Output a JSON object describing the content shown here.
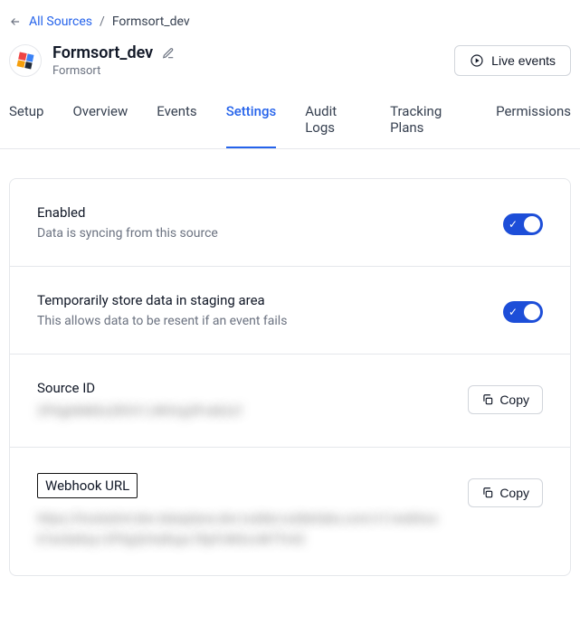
{
  "breadcrumb": {
    "root": "All Sources",
    "current": "Formsort_dev"
  },
  "header": {
    "title": "Formsort_dev",
    "subtitle": "Formsort",
    "live_events_label": "Live events"
  },
  "tabs": [
    {
      "label": "Setup",
      "active": false
    },
    {
      "label": "Overview",
      "active": false
    },
    {
      "label": "Events",
      "active": false
    },
    {
      "label": "Settings",
      "active": true
    },
    {
      "label": "Audit Logs",
      "active": false
    },
    {
      "label": "Tracking Plans",
      "active": false
    },
    {
      "label": "Permissions",
      "active": false
    }
  ],
  "sections": {
    "enabled": {
      "title": "Enabled",
      "desc": "Data is syncing from this source"
    },
    "staging": {
      "title": "Temporarily store data in staging area",
      "desc": "This allows data to be resent if an event fails"
    },
    "source_id": {
      "title": "Source ID",
      "value": "2PXgbNMDs2ROV1JWhVg3Pvd62cf",
      "copy_label": "Copy"
    },
    "webhook": {
      "title": "Webhook URL",
      "value": "https://hostedmt-dev-dataplane.dev-rudder.rudderlabs.com/v1/webhook?writeKey=2PXgQrHaRupc78pFvMGcvM7Tn42",
      "copy_label": "Copy"
    }
  }
}
